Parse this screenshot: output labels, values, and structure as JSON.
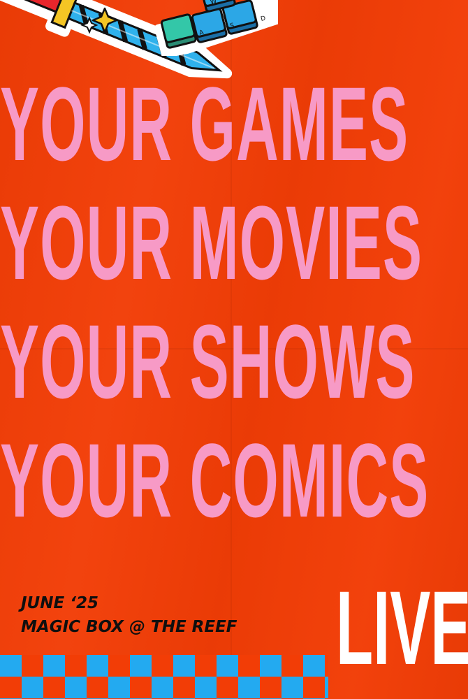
{
  "headline": {
    "lines": [
      "YOUR GAMES",
      "YOUR MOVIES",
      "YOUR SHOWS",
      "YOUR COMICS"
    ]
  },
  "event": {
    "date": "JUNE ‘25",
    "venue": "MAGIC BOX @ THE REEF"
  },
  "live_label": "LIVE.",
  "stickers": {
    "sword": "sword-sticker-icon",
    "keyboard": "wasd-keys-sticker-icon",
    "keys": [
      "W",
      "A",
      "S",
      "D"
    ]
  },
  "colors": {
    "background": "#f23d06",
    "headline": "#f79ac6",
    "event_text": "#0f0f0f",
    "live": "#ffffff",
    "checker": "#23aaf0"
  }
}
